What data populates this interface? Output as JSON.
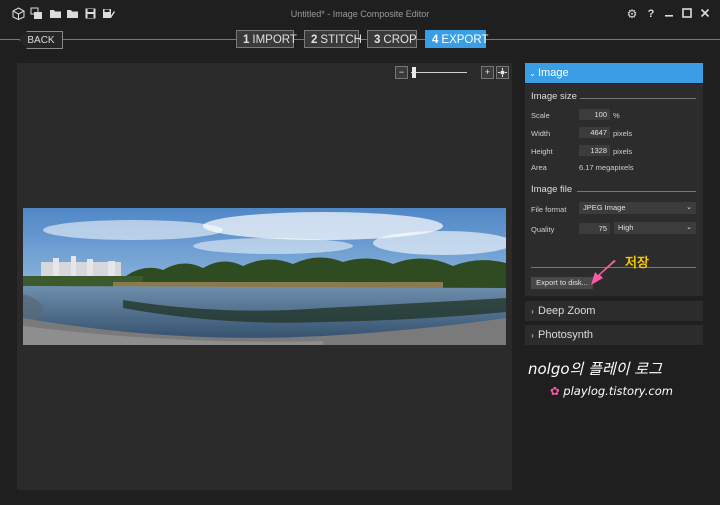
{
  "window": {
    "title": "Untitled* - Image Composite Editor"
  },
  "nav": {
    "back_label": "BACK",
    "steps": [
      {
        "num": "1",
        "label": "IMPORT"
      },
      {
        "num": "2",
        "label": "STITCH"
      },
      {
        "num": "3",
        "label": "CROP"
      },
      {
        "num": "4",
        "label": "EXPORT"
      }
    ],
    "active_step": 4
  },
  "toolbar_icons": [
    "new-project-icon",
    "new-panorama-icon",
    "open-folder-icon",
    "save-icon",
    "save-as-icon"
  ],
  "window_icons": [
    "settings-icon",
    "help-icon",
    "minimize-icon",
    "maximize-icon",
    "close-icon"
  ],
  "panel": {
    "image_section": {
      "header": "Image",
      "size_title": "Image size",
      "scale_label": "Scale",
      "scale_value": "100",
      "scale_unit": "%",
      "width_label": "Width",
      "width_value": "4647",
      "width_unit": "pixels",
      "height_label": "Height",
      "height_value": "1328",
      "height_unit": "pixels",
      "area_label": "Area",
      "area_value": "6.17 megapixels",
      "file_title": "Image file",
      "format_label": "File format",
      "format_value": "JPEG Image",
      "quality_label": "Quality",
      "quality_value": "75",
      "quality_level": "High",
      "export_button": "Export to disk..."
    },
    "deep_zoom_label": "Deep Zoom",
    "photosynth_label": "Photosynth"
  },
  "annotation": {
    "text": "저장"
  },
  "watermark": {
    "line1": "nolgo의 플레이 로그",
    "line2": "playlog.tistory.com"
  },
  "colors": {
    "accent": "#3a9ee6",
    "annotation": "#f5c800",
    "arrow": "#ff5aa5"
  }
}
